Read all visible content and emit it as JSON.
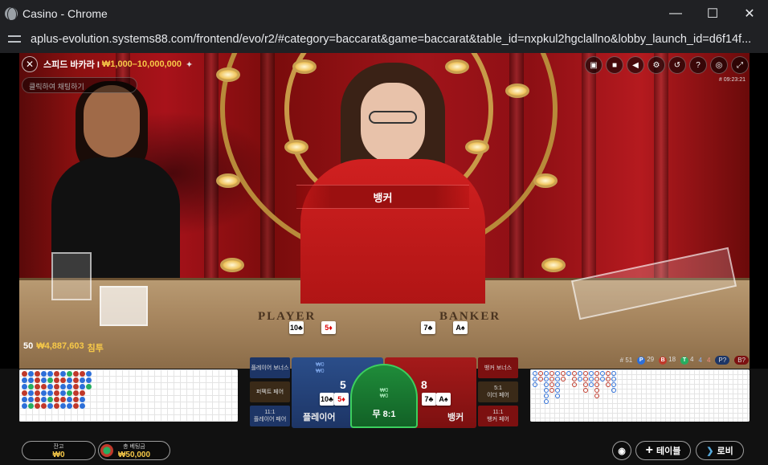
{
  "window": {
    "title": "Casino - Chrome",
    "minimize": "—",
    "maximize": "☐",
    "close": "✕"
  },
  "address": {
    "url": "aplus-evolution.systems88.com/frontend/evo/r2/#category=baccarat&game=baccarat&table_id=nxpkul2hgclallno&lobby_launch_id=d6f14f..."
  },
  "game": {
    "table_name": "스피드 바카라 I",
    "limits": "₩1,000–10,000,000",
    "chat_placeholder": "클릭하여 채팅하기",
    "game_id": "# 09:23:21",
    "banner": "뱅커",
    "player_label": "PLAYER",
    "banker_label": "BANKER",
    "player_count": "50",
    "total_bets": "₩4,887,603",
    "total_bets_label": "침투",
    "player_cards": [
      {
        "rank": "10",
        "suit": "♣",
        "red": false
      },
      {
        "rank": "5",
        "suit": "♦",
        "red": true
      }
    ],
    "banker_cards": [
      {
        "rank": "7",
        "suit": "♣",
        "red": false
      },
      {
        "rank": "A",
        "suit": "♠",
        "red": false
      }
    ]
  },
  "stats": {
    "round": "# 51",
    "player": "29",
    "banker": "18",
    "tie": "4",
    "ppair": "4",
    "bpair": "4",
    "p_tag": "P?",
    "b_tag": "B?"
  },
  "bets": {
    "player_bonus": "플레이어 보너스",
    "perfect_pair": "퍼펙트 페어",
    "player_pair_odds": "11:1",
    "player_pair": "플레이어 페어",
    "banker_bonus": "뱅커 보너스",
    "either_odds": "5:1",
    "either_pair": "이더 페어",
    "banker_pair_odds": "11:1",
    "banker_pair": "뱅커 페어",
    "player_score": "5",
    "banker_score": "8",
    "player": "플레이어",
    "banker": "뱅커",
    "tie": "무 8:1",
    "tie_w": "₩0",
    "tie_b": "₩0",
    "player_w": "₩0",
    "player_b": "₩0"
  },
  "footer": {
    "balance_label": "잔고",
    "balance": "₩0",
    "total_bet_label": "총 베팅금",
    "total_bet": "₩50,000",
    "table_btn": "테이블",
    "lobby_btn": "로비"
  },
  "colors": {
    "banker": "#c0392b",
    "player": "#2e6fd8",
    "tie": "#27ae60",
    "gold": "#f7c948"
  }
}
